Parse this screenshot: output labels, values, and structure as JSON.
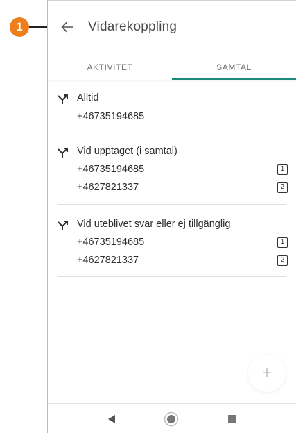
{
  "annotation": {
    "marker": "1",
    "color": "#ef7d1a"
  },
  "header": {
    "title": "Vidarekoppling",
    "back_icon": "arrow-left-icon"
  },
  "tabs": [
    {
      "label": "AKTIVITET",
      "active": false
    },
    {
      "label": "SAMTAL",
      "active": true
    }
  ],
  "accent_color": "#1c8c7a",
  "forwarding": [
    {
      "label": "Alltid",
      "icon": "call-forward-icon",
      "numbers": [
        {
          "number": "+46735194685",
          "badge": ""
        }
      ]
    },
    {
      "label": "Vid upptaget (i samtal)",
      "icon": "call-forward-icon",
      "numbers": [
        {
          "number": "+46735194685",
          "badge": "1"
        },
        {
          "number": "+4627821337",
          "badge": "2"
        }
      ]
    },
    {
      "label": "Vid uteblivet svar eller ej tillgänglig",
      "icon": "call-forward-icon",
      "numbers": [
        {
          "number": "+46735194685",
          "badge": "1"
        },
        {
          "number": "+4627821337",
          "badge": "2"
        }
      ]
    }
  ],
  "fab": {
    "label": "+"
  },
  "navbar": {
    "back_icon": "nav-back-triangle-icon",
    "home_icon": "nav-home-circle-icon",
    "recents_icon": "nav-recents-square-icon"
  }
}
